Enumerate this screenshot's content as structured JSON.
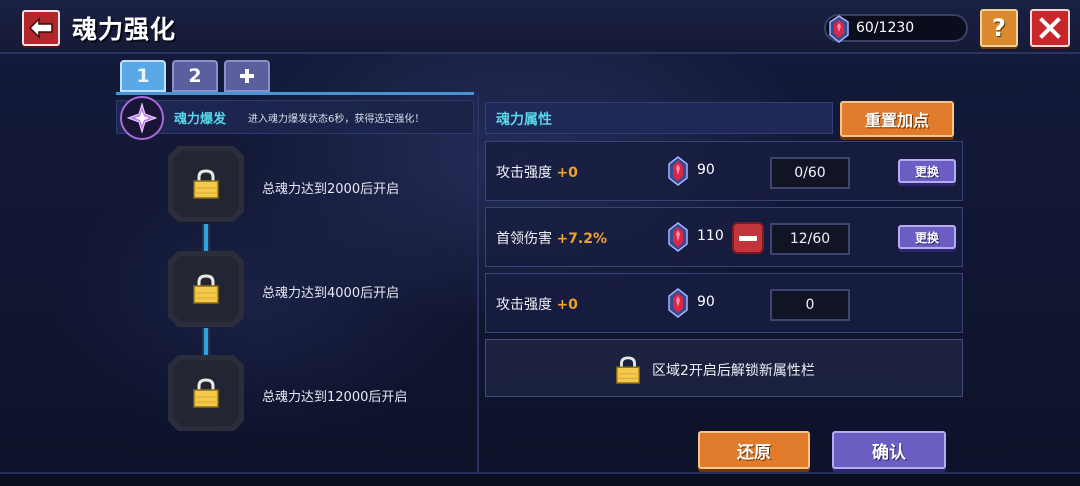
{
  "header": {
    "title": "魂力强化",
    "currency_value": "60/1230",
    "help_label": "?",
    "back_icon": "arrow-left-icon",
    "close_icon": "close-x-icon"
  },
  "tabs": [
    {
      "label": "1",
      "active": true
    },
    {
      "label": "2",
      "active": false
    },
    {
      "label": "+",
      "active": false
    }
  ],
  "burst": {
    "title": "魂力爆发",
    "description": "进入魂力爆发状态6秒，获得选定强化！"
  },
  "unlock_nodes": [
    {
      "label": "总魂力达到2000后开启"
    },
    {
      "label": "总魂力达到4000后开启"
    },
    {
      "label": "总魂力达到12000后开启"
    }
  ],
  "attributes": {
    "header": "魂力属性",
    "reset_label": "重置加点",
    "rows": [
      {
        "name": "攻击强度",
        "bonus": "+0",
        "cost": "90",
        "count": "0/60",
        "swap_label": "更换",
        "has_minus": false,
        "has_swap": true
      },
      {
        "name": "首领伤害",
        "bonus": "+7.2%",
        "cost": "110",
        "count": "12/60",
        "swap_label": "更换",
        "has_minus": true,
        "has_swap": true
      },
      {
        "name": "攻击强度",
        "bonus": "+0",
        "cost": "90",
        "count": "0",
        "swap_label": "",
        "has_minus": false,
        "has_swap": false
      }
    ],
    "locked_text": "区域2开启后解锁新属性栏"
  },
  "footer": {
    "restore_label": "还原",
    "confirm_label": "确认"
  },
  "colors": {
    "accent_cyan": "#58d6e8",
    "bonus_orange": "#f0a030",
    "orange_button": "#e07b2c",
    "purple_button": "#6a5ec2",
    "red_button": "#c8262b"
  }
}
